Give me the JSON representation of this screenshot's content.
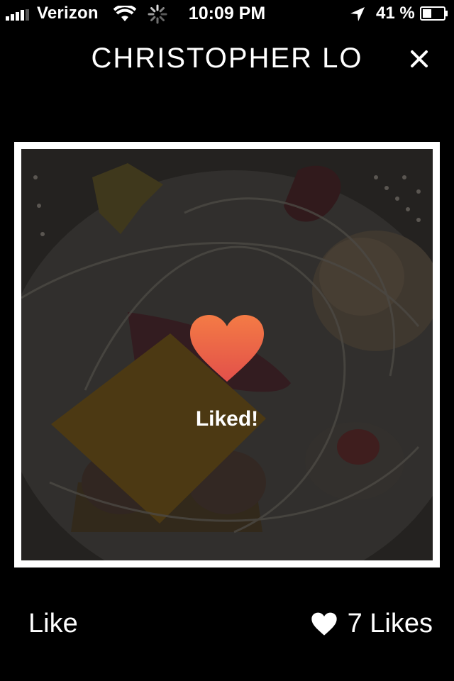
{
  "status_bar": {
    "carrier": "Verizon",
    "time": "10:09 PM",
    "battery_percent": "41 %",
    "icons": [
      "signal-bars-icon",
      "wifi-icon",
      "activity-spinner-icon",
      "location-arrow-icon",
      "battery-icon"
    ]
  },
  "header": {
    "title": "CHRISTOPHER LO",
    "close_icon": "close-icon"
  },
  "photo": {
    "overlay_icon": "heart-icon",
    "overlay_text": "Liked!",
    "heart_color_top": "#F47B45",
    "heart_color_bottom": "#E2504A"
  },
  "footer": {
    "like_label": "Like",
    "likes_icon": "heart-icon",
    "likes_count_label": "7 Likes"
  }
}
